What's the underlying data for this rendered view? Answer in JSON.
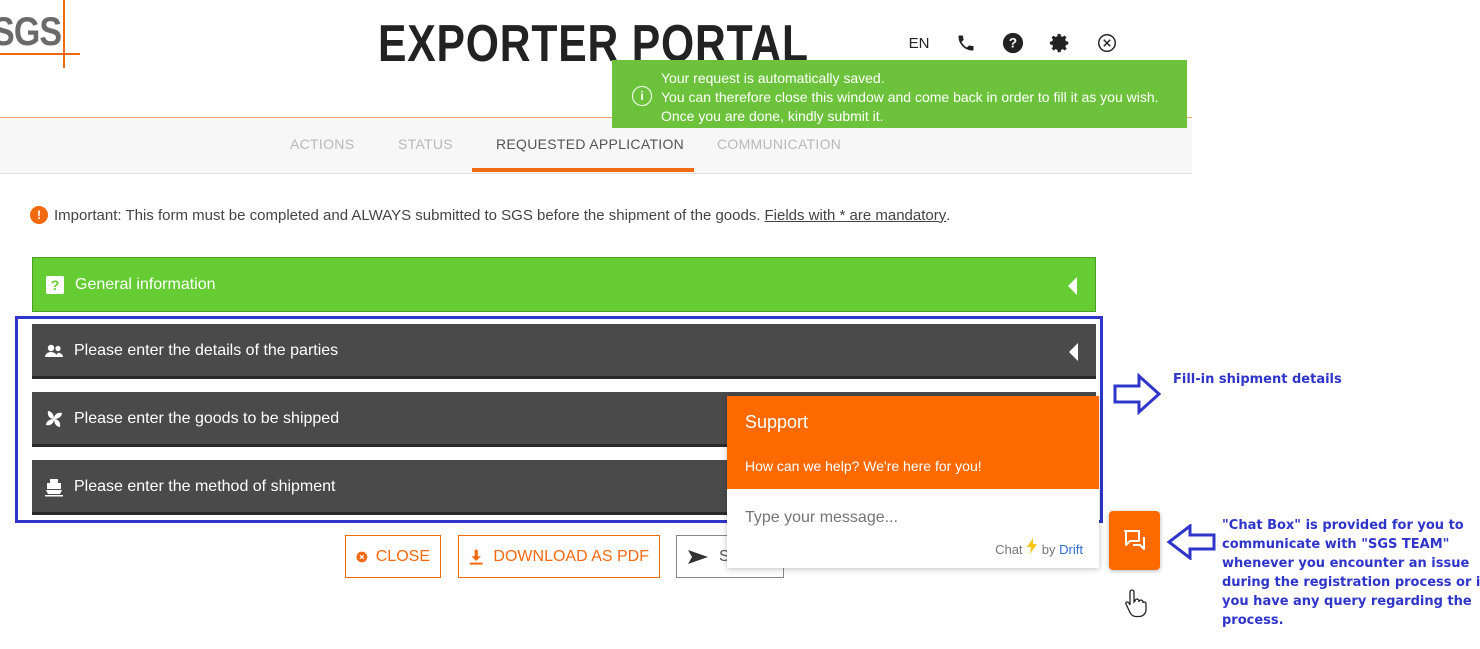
{
  "header": {
    "logo_text": "SGS",
    "title": "EXPORTER PORTAL",
    "language": "EN",
    "icons": [
      "phone-icon",
      "help-icon",
      "settings-icon",
      "close-circle-icon"
    ]
  },
  "toast": {
    "line1": "Your request is automatically saved.",
    "line2": "You can therefore close this window and come back in order to fill it as you wish.",
    "line3": "Once you are done, kindly submit it."
  },
  "tabs": [
    {
      "label": "ACTIONS",
      "active": false
    },
    {
      "label": "STATUS",
      "active": false
    },
    {
      "label": "REQUESTED APPLICATION",
      "active": true
    },
    {
      "label": "COMMUNICATION",
      "active": false
    }
  ],
  "note": {
    "prefix": "Important",
    "text": ": This form must be completed and ALWAYS submitted to SGS before the shipment of the goods.",
    "link": "Fields with * are mandatory",
    "suffix": "."
  },
  "sections": [
    {
      "label": "General information",
      "icon": "question-icon"
    },
    {
      "label": "Please enter the details of the parties",
      "icon": "users-icon"
    },
    {
      "label": "Please enter the goods to be shipped",
      "icon": "fan-icon"
    },
    {
      "label": "Please enter the method of shipment",
      "icon": "ship-icon"
    }
  ],
  "buttons": {
    "close": "CLOSE",
    "download": "DOWNLOAD AS PDF",
    "submit_partial": "S"
  },
  "chat": {
    "title": "Support",
    "subtitle": "How can we help? We're here for you!",
    "placeholder": "Type your message...",
    "powered_prefix": "Chat",
    "powered_by": "by",
    "powered_brand": "Drift"
  },
  "annotations": {
    "shipment": "Fill-in shipment details",
    "chatbox": [
      "\"Chat Box\" is provided for you to",
      "communicate with \"SGS TEAM\"",
      "whenever you encounter an issue",
      "during the registration process or if",
      "you have any query regarding the",
      "process."
    ]
  },
  "colors": {
    "accent": "#f26a10",
    "green": "#66cc33",
    "dark_panel": "#4a4a4a",
    "annotation_blue": "#2f35c9"
  }
}
